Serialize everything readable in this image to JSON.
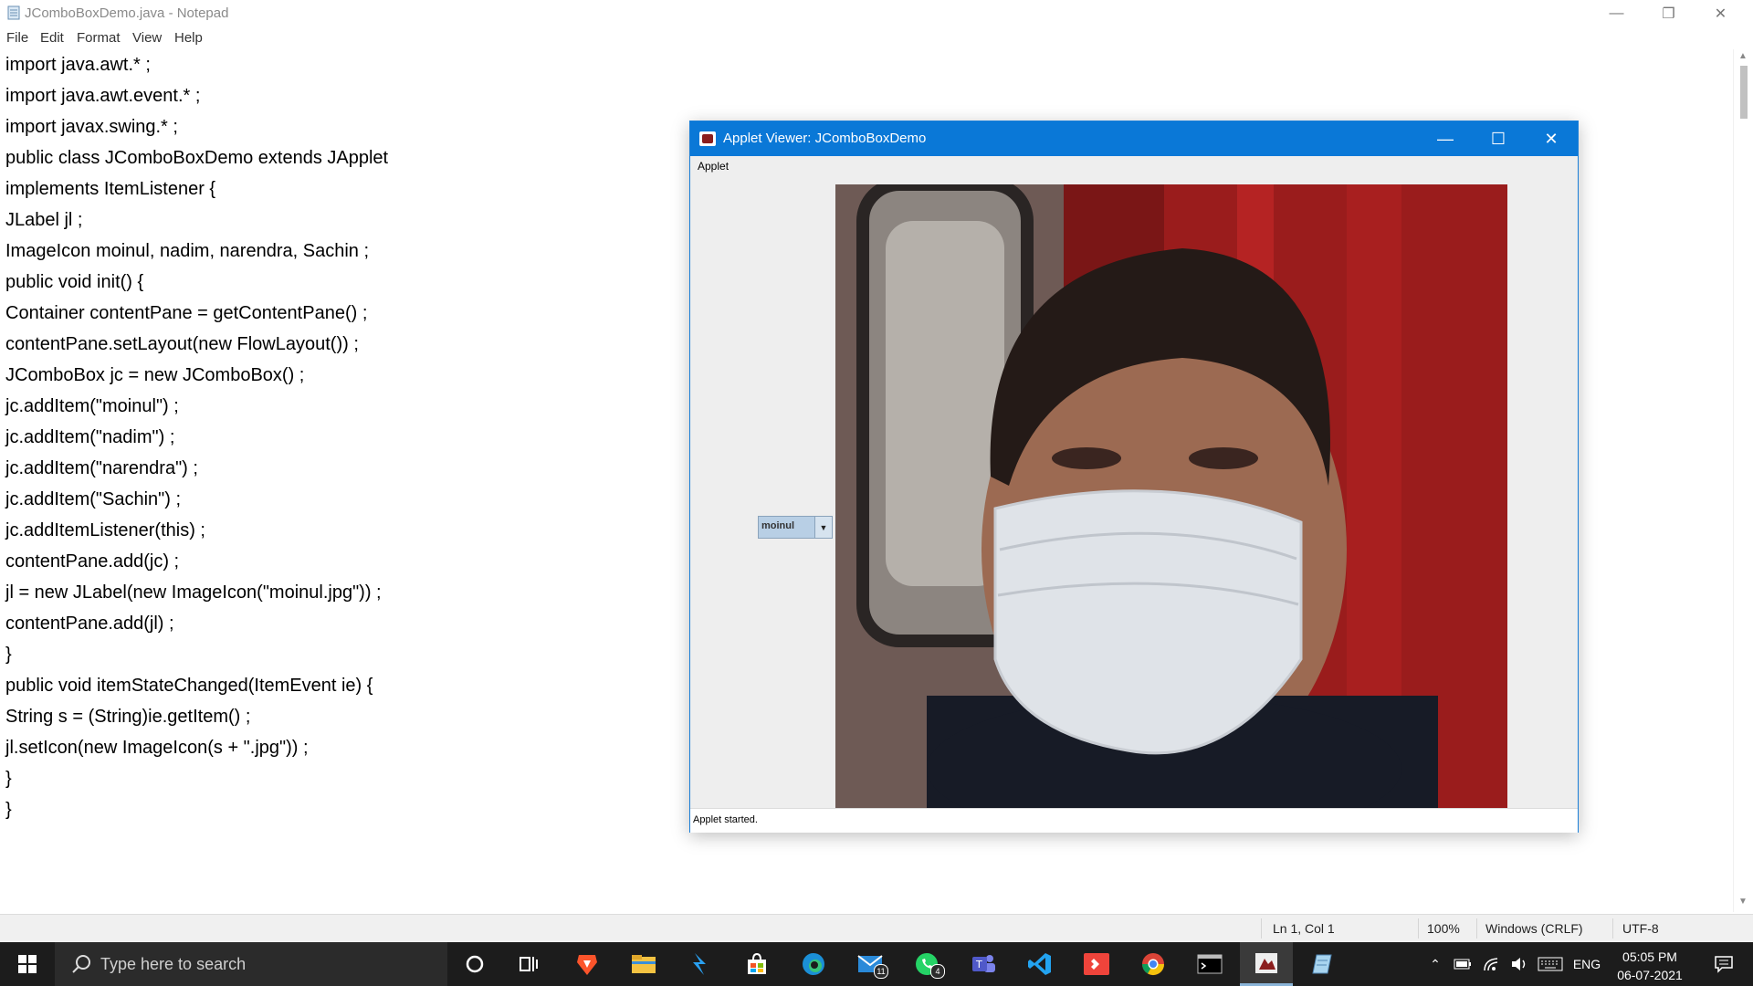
{
  "notepad": {
    "title": "JComboBoxDemo.java - Notepad",
    "menu": [
      "File",
      "Edit",
      "Format",
      "View",
      "Help"
    ],
    "code_lines": [
      "import java.awt.* ;",
      "import java.awt.event.* ;",
      "import javax.swing.* ;",
      "public class JComboBoxDemo extends JApplet",
      "implements ItemListener {",
      "JLabel jl ;",
      "ImageIcon moinul, nadim, narendra, Sachin ;",
      "public void init() {",
      "Container contentPane = getContentPane() ;",
      "contentPane.setLayout(new FlowLayout()) ;",
      "JComboBox jc = new JComboBox() ;",
      "jc.addItem(\"moinul\") ;",
      "jc.addItem(\"nadim\") ;",
      "jc.addItem(\"narendra\") ;",
      "jc.addItem(\"Sachin\") ;",
      "jc.addItemListener(this) ;",
      "contentPane.add(jc) ;",
      "jl = new JLabel(new ImageIcon(\"moinul.jpg\")) ;",
      "contentPane.add(jl) ;",
      "}",
      "public void itemStateChanged(ItemEvent ie) {",
      "String s = (String)ie.getItem() ;",
      "jl.setIcon(new ImageIcon(s + \".jpg\")) ;",
      "}",
      "}"
    ],
    "status": {
      "position": "Ln 1, Col 1",
      "zoom": "100%",
      "line_ending": "Windows (CRLF)",
      "encoding": "UTF-8"
    }
  },
  "applet": {
    "title": "Applet Viewer: JComboBoxDemo",
    "menu": "Applet",
    "combo_value": "moinul",
    "status": "Applet started."
  },
  "taskbar": {
    "search_placeholder": "Type here to search",
    "mail_badge": "11",
    "whatsapp_badge": "4",
    "language": "ENG",
    "time": "05:05 PM",
    "date": "06-07-2021"
  },
  "colors": {
    "applet_titlebar": "#0a78d7",
    "taskbar": "#1c1c1c"
  }
}
